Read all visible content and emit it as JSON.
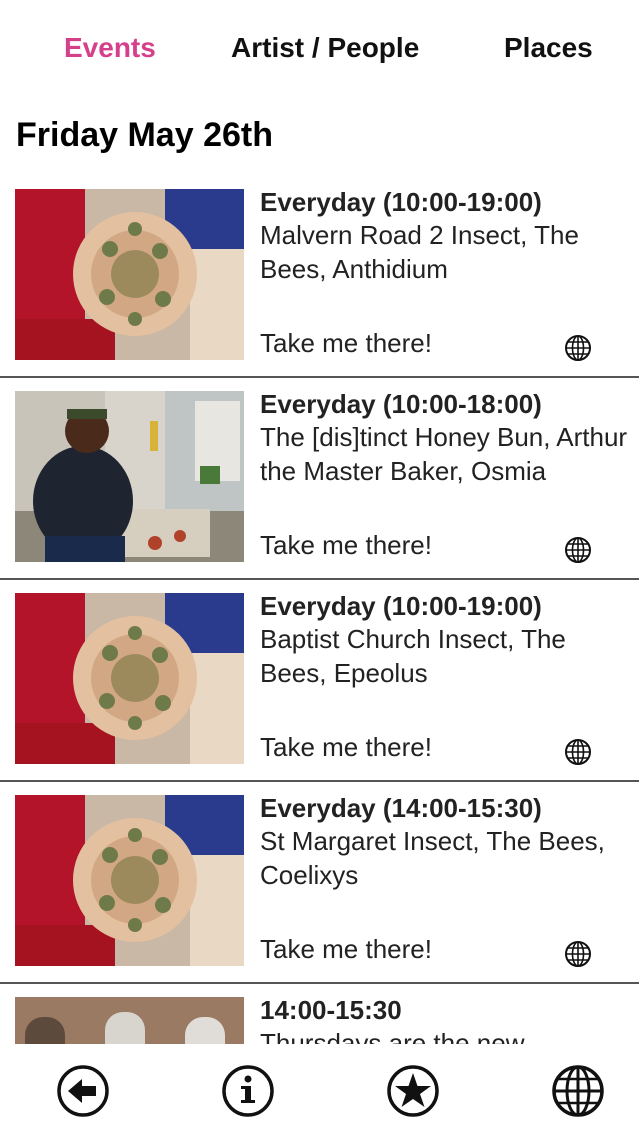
{
  "tabs": {
    "events": "Events",
    "artist": "Artist / People",
    "places": "Places",
    "active_color": "#d6408a"
  },
  "date_heading": "Friday May 26th",
  "link_label": "Take me there!",
  "events": [
    {
      "time": "Everyday (10:00-19:00)",
      "title": "Malvern Road 2 Insect, The Bees, Anthidium",
      "image": "hands-circle-photo"
    },
    {
      "time": "Everyday (10:00-18:00)",
      "title": "The [dis]tinct Honey Bun, Arthur the Master Baker, Osmia",
      "image": "baker-photo"
    },
    {
      "time": "Everyday (10:00-19:00)",
      "title": "Baptist Church Insect, The Bees, Epeolus",
      "image": "hands-circle-photo"
    },
    {
      "time": "Everyday (14:00-15:30)",
      "title": "St Margaret Insect, The Bees, Coelixys",
      "image": "hands-circle-photo"
    },
    {
      "time": "14:00-15:30",
      "title": "Thursdays are the new",
      "image": "brick-wall-photo"
    }
  ],
  "bottom_nav": {
    "icons": [
      "back-arrow-icon",
      "info-icon",
      "star-icon",
      "globe-icon"
    ]
  }
}
